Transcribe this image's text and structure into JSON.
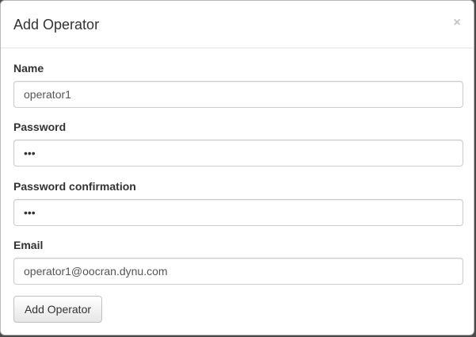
{
  "modal": {
    "title": "Add Operator",
    "close_glyph": "×"
  },
  "form": {
    "name": {
      "label": "Name",
      "value": "operator1"
    },
    "password": {
      "label": "Password",
      "value": "•••"
    },
    "password_confirmation": {
      "label": "Password confirmation",
      "value": "•••"
    },
    "email": {
      "label": "Email",
      "value": "operator1@oocran.dynu.com"
    },
    "submit_label": "Add Operator"
  }
}
